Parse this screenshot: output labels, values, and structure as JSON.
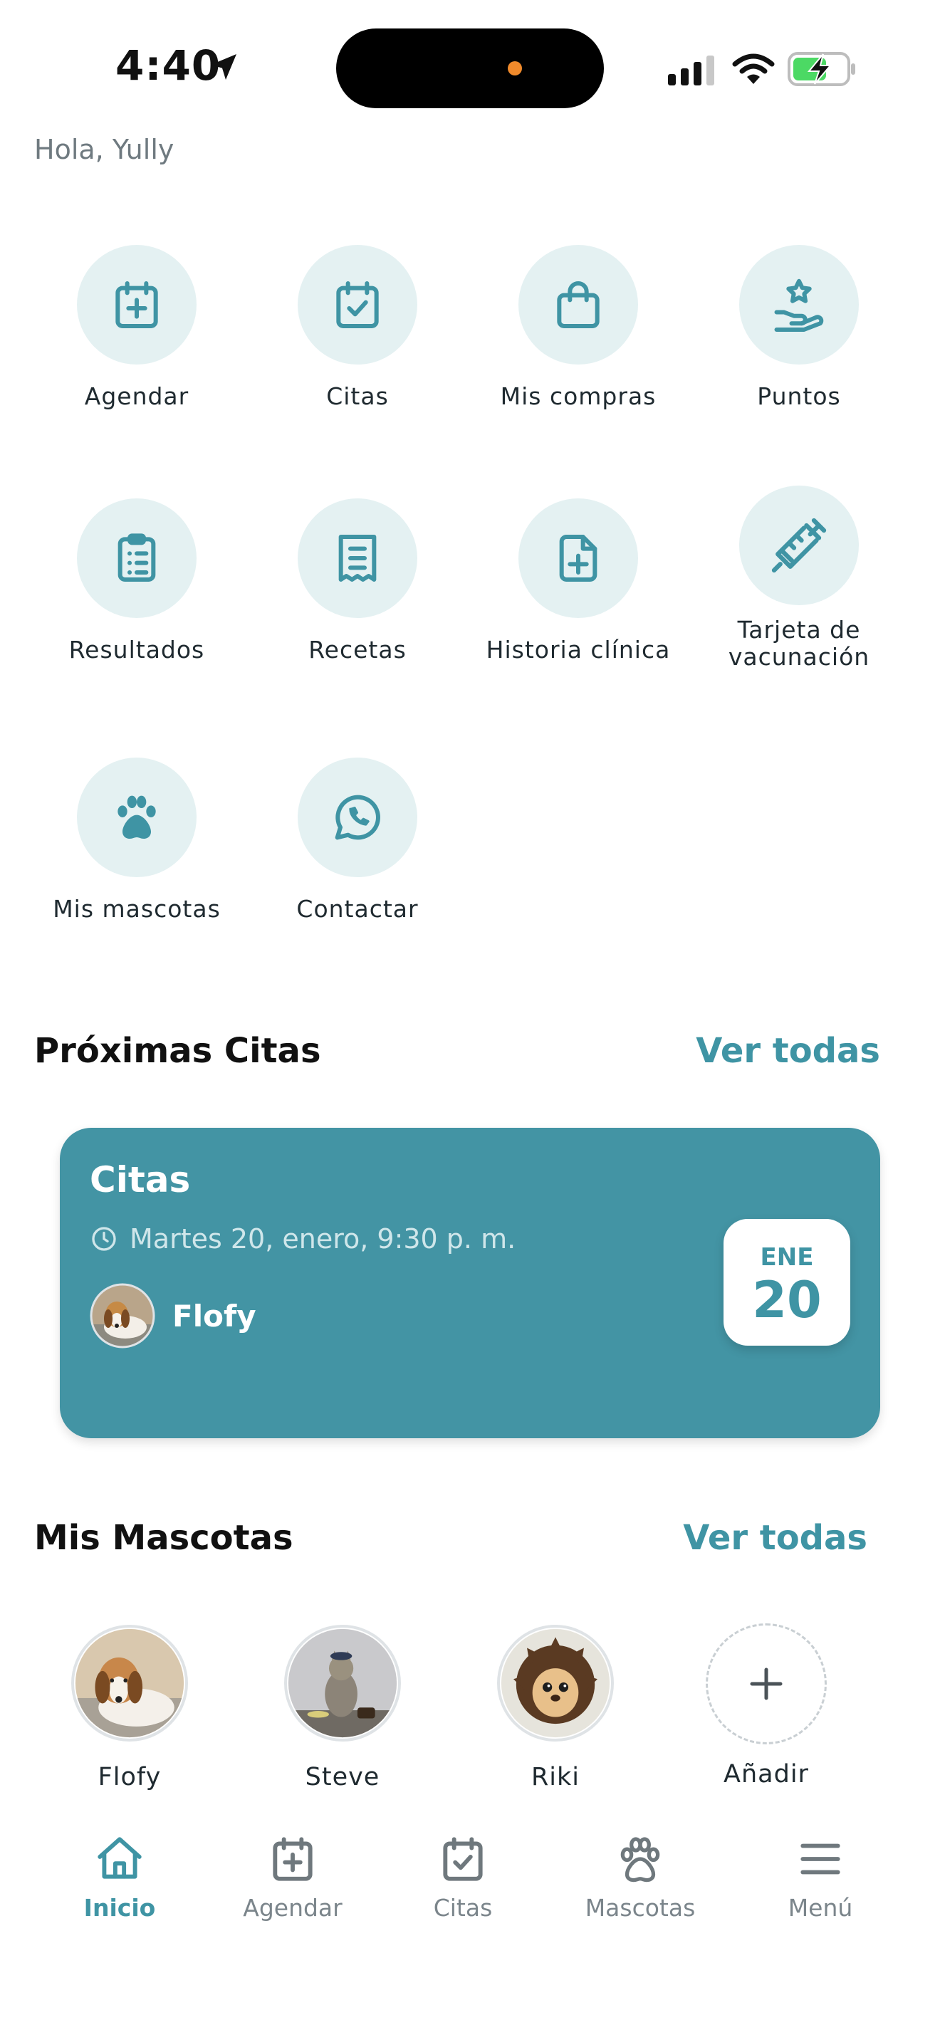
{
  "status_bar": {
    "time": "4:40"
  },
  "greeting": "Hola, Yully",
  "quick_actions": [
    {
      "label": "Agendar",
      "icon": "calendar-plus-icon"
    },
    {
      "label": "Citas",
      "icon": "calendar-check-icon"
    },
    {
      "label": "Mis compras",
      "icon": "shopping-bag-icon"
    },
    {
      "label": "Puntos",
      "icon": "hand-star-icon"
    },
    {
      "label": "Resultados",
      "icon": "clipboard-list-icon"
    },
    {
      "label": "Recetas",
      "icon": "receipt-icon"
    },
    {
      "label": "Historia clínica",
      "icon": "file-plus-icon"
    },
    {
      "label": "Tarjeta de vacunación",
      "icon": "syringe-icon"
    },
    {
      "label": "Mis mascotas",
      "icon": "paw-icon"
    },
    {
      "label": "Contactar",
      "icon": "whatsapp-icon"
    }
  ],
  "upcoming": {
    "title": "Próximas Citas",
    "see_all": "Ver todas",
    "card": {
      "title": "Citas",
      "datetime": "Martes 20, enero, 9:30 p. m.",
      "pet_name": "Flofy",
      "month": "ENE",
      "day": "20"
    }
  },
  "pets_section": {
    "title": "Mis Mascotas",
    "see_all": "Ver todas",
    "pets": [
      {
        "name": "Flofy"
      },
      {
        "name": "Steve"
      },
      {
        "name": "Riki"
      }
    ],
    "add_label": "Añadir"
  },
  "bottom_nav": [
    {
      "label": "Inicio",
      "icon": "home-icon",
      "active": true
    },
    {
      "label": "Agendar",
      "icon": "calendar-plus-icon",
      "active": false
    },
    {
      "label": "Citas",
      "icon": "calendar-check-icon",
      "active": false
    },
    {
      "label": "Mascotas",
      "icon": "paw-icon",
      "active": false
    },
    {
      "label": "Menú",
      "icon": "menu-icon",
      "active": false
    }
  ],
  "colors": {
    "accent": "#3f94a4",
    "card": "#4394a4",
    "tile_bg": "#e4f1f2"
  }
}
